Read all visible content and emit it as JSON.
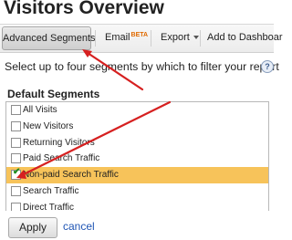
{
  "page": {
    "title": "Visitors Overview"
  },
  "toolbar": {
    "advanced_segments": "Advanced Segments",
    "email": "Email",
    "email_badge": "BETA",
    "export": "Export",
    "add_to_dashboard": "Add to Dashboar"
  },
  "panel": {
    "instruction": "Select up to four segments by which to filter your report",
    "help_icon": "?",
    "section_title": "Default Segments",
    "segments": [
      {
        "label": "All Visits",
        "checked": false
      },
      {
        "label": "New Visitors",
        "checked": false
      },
      {
        "label": "Returning Visitors",
        "checked": false
      },
      {
        "label": "Paid Search Traffic",
        "checked": false
      },
      {
        "label": "Non-paid Search Traffic",
        "checked": true
      },
      {
        "label": "Search Traffic",
        "checked": false
      },
      {
        "label": "Direct Traffic",
        "checked": false
      }
    ],
    "apply_label": "Apply",
    "cancel_label": "cancel"
  },
  "colors": {
    "selected_row": "#f7c35a",
    "arrow": "#d62020",
    "link": "#1f55b4",
    "beta": "#e06a00"
  },
  "icons": {
    "checked": "check-icon",
    "help": "help-icon",
    "dropdown": "caret-down-icon"
  }
}
